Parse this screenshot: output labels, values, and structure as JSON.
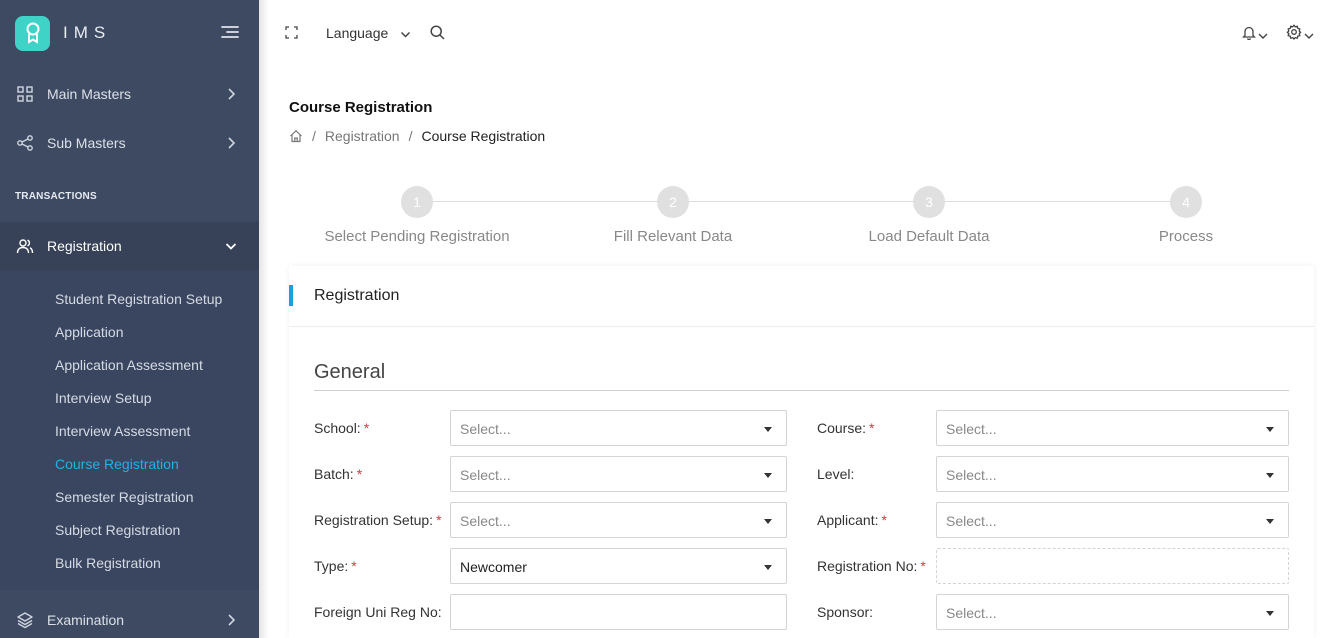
{
  "app": {
    "name": "IMS"
  },
  "sidebar": {
    "top_items": [
      {
        "label": "Main Masters",
        "icon": "grid-icon"
      },
      {
        "label": "Sub Masters",
        "icon": "share-icon"
      }
    ],
    "section_title": "TRANSACTIONS",
    "active_group": {
      "label": "Registration",
      "icon": "users-icon"
    },
    "sub_items": [
      "Student Registration Setup",
      "Application",
      "Application Assessment",
      "Interview Setup",
      "Interview Assessment",
      "Course Registration",
      "Semester Registration",
      "Subject Registration",
      "Bulk Registration"
    ],
    "active_sub_index": 5,
    "bottom_item": {
      "label": "Examination",
      "icon": "layers-icon"
    }
  },
  "topbar": {
    "language_label": "Language"
  },
  "page": {
    "title": "Course Registration",
    "breadcrumb": [
      "Registration",
      "Course Registration"
    ]
  },
  "steps": [
    {
      "number": "1",
      "label": "Select Pending Registration"
    },
    {
      "number": "2",
      "label": "Fill Relevant Data"
    },
    {
      "number": "3",
      "label": "Load Default Data"
    },
    {
      "number": "4",
      "label": "Process"
    }
  ],
  "card": {
    "title": "Registration",
    "section": "General"
  },
  "form": {
    "school": {
      "label": "School:",
      "value": "Select..."
    },
    "course": {
      "label": "Course:",
      "value": "Select..."
    },
    "batch": {
      "label": "Batch:",
      "value": "Select..."
    },
    "level": {
      "label": "Level:",
      "value": "Select..."
    },
    "registration_setup": {
      "label": "Registration Setup:",
      "value": "Select..."
    },
    "applicant": {
      "label": "Applicant:",
      "value": "Select..."
    },
    "type": {
      "label": "Type:",
      "value": "Newcomer"
    },
    "registration_no": {
      "label": "Registration No:",
      "value": ""
    },
    "foreign_uni_reg_no": {
      "label": "Foreign Uni Reg No:",
      "value": ""
    },
    "sponsor": {
      "label": "Sponsor:",
      "value": "Select..."
    },
    "required_mark": "*"
  },
  "colors": {
    "sidebar_bg": "#3e4a62",
    "accent": "#1d9ee0",
    "active_link": "#22b0e8",
    "logo": "#3fd3c8",
    "required": "#d9363e"
  }
}
